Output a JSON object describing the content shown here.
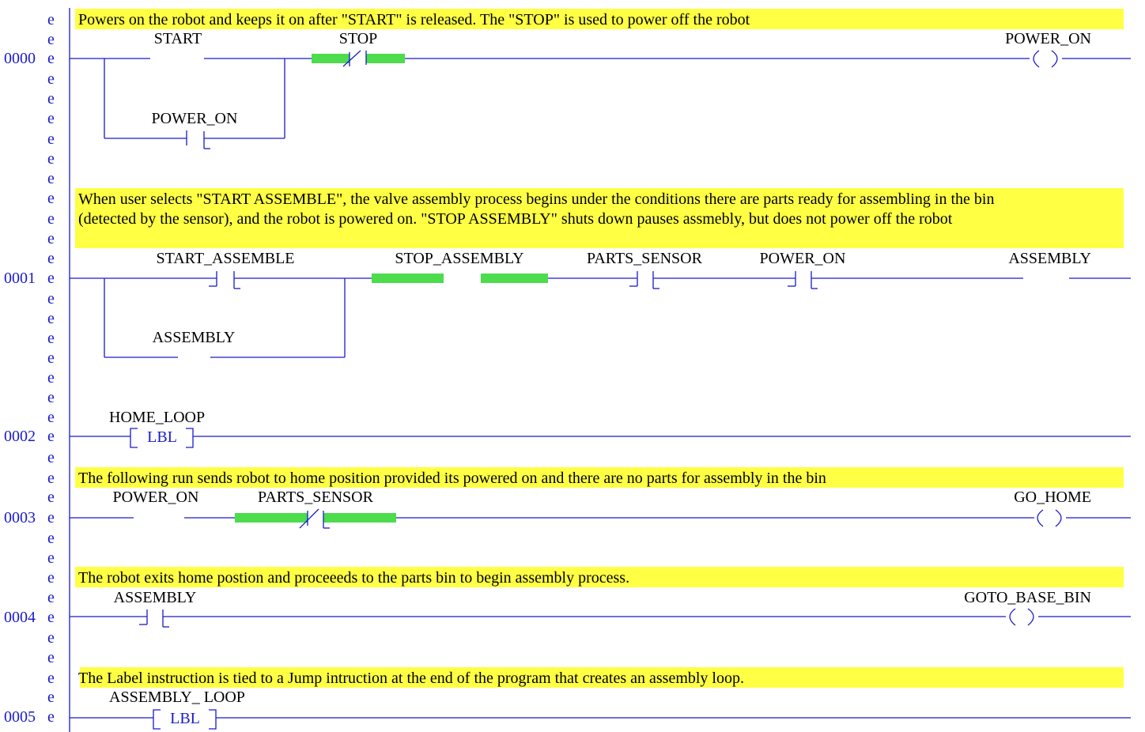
{
  "gutter": {
    "marker": "e",
    "rung_numbers": [
      "0000",
      "0001",
      "0002",
      "0003",
      "0004",
      "0005"
    ]
  },
  "rungs": [
    {
      "number": "0000",
      "comment_lines": [
        "Powers on the robot and keeps it on after \"START\" is released. The \"STOP\" is used to power off the robot"
      ],
      "start": "START",
      "stop": "STOP",
      "branch": "POWER_ON",
      "coil": "POWER_ON"
    },
    {
      "number": "0001",
      "comment_lines": [
        "When user selects \"START ASSEMBLE\", the valve assembly process begins under the conditions there are parts ready for assembling in the bin",
        "(detected by the sensor), and the robot is powered on. \"STOP ASSEMBLY\" shuts down pauses assmebly, but does not power off the robot"
      ],
      "c1": "START_ASSEMBLE",
      "c2": "STOP_ASSEMBLY",
      "c3": "PARTS_SENSOR",
      "c4": "POWER_ON",
      "branch": "ASSEMBLY",
      "coil": "ASSEMBLY"
    },
    {
      "number": "0002",
      "label_tag": "HOME_LOOP",
      "instruction": "LBL"
    },
    {
      "number": "0003",
      "comment_lines": [
        "The following run sends robot to home position provided its powered on and there are no parts for assembly in the bin"
      ],
      "c1": "POWER_ON",
      "c2": "PARTS_SENSOR",
      "coil": "GO_HOME"
    },
    {
      "number": "0004",
      "comment_lines": [
        "The robot exits home postion and proceeeds to the parts bin to begin assembly process."
      ],
      "c1": "ASSEMBLY",
      "coil": "GOTO_BASE_BIN"
    },
    {
      "number": "0005",
      "comment_lines": [
        " The Label instruction is tied to a Jump intruction at the end of the program that creates an assembly loop."
      ],
      "label_tag": "ASSEMBLY_ LOOP",
      "instruction": "LBL"
    }
  ],
  "colors": {
    "wire": "#1a1acc",
    "comment_highlight": "#ffff44",
    "energized_highlight": "#4cdc4c"
  }
}
